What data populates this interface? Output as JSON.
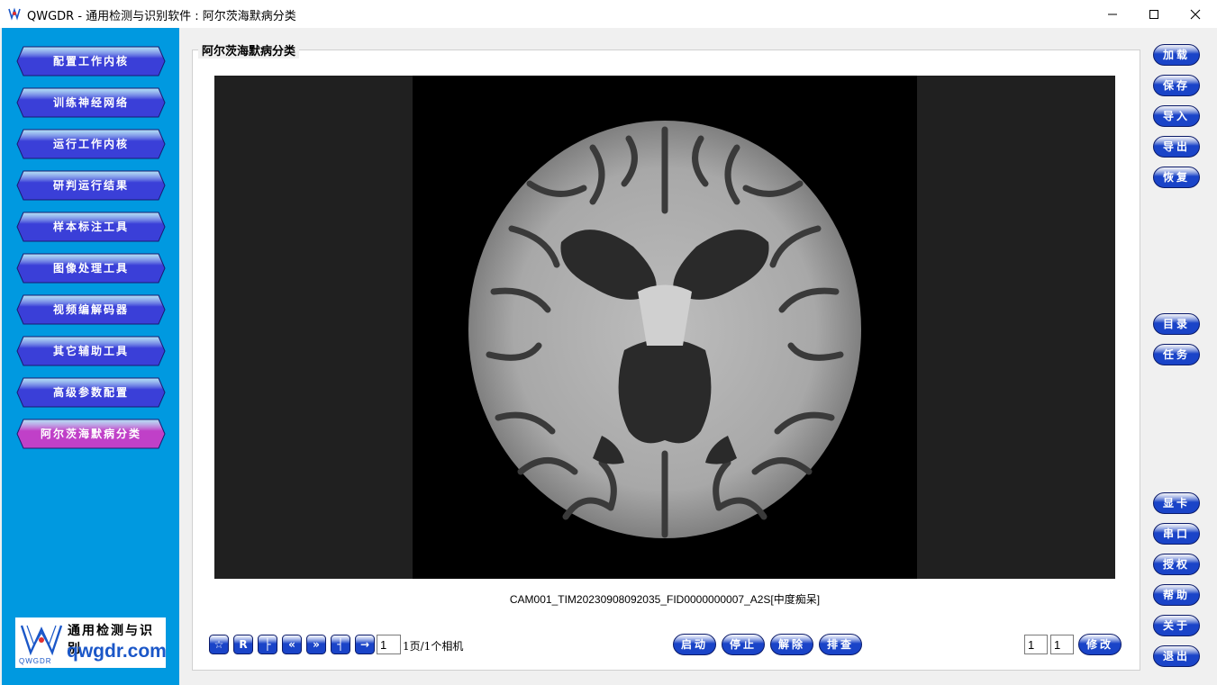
{
  "window": {
    "title": "QWGDR - 通用检测与识别软件 : 阿尔茨海默病分类"
  },
  "sidebar": {
    "items": [
      {
        "label": "配置工作内核"
      },
      {
        "label": "训练神经网络"
      },
      {
        "label": "运行工作内核"
      },
      {
        "label": "研判运行结果"
      },
      {
        "label": "样本标注工具"
      },
      {
        "label": "图像处理工具"
      },
      {
        "label": "视频编解码器"
      },
      {
        "label": "其它辅助工具"
      },
      {
        "label": "高级参数配置"
      },
      {
        "label": "阿尔茨海默病分类",
        "active": true
      }
    ],
    "logo": {
      "title": "通用检测与识别",
      "url_text": "qwgdr.com",
      "brand": "QWGDR"
    }
  },
  "main": {
    "group_title": "阿尔茨海默病分类",
    "caption": "CAM001_TIM20230908092035_FID0000000007_A2S[中度痴呆]",
    "nav_buttons": [
      {
        "icon": "star-icon",
        "glyph": "☆"
      },
      {
        "icon": "r-icon",
        "glyph": "R"
      },
      {
        "icon": "first-icon",
        "glyph": "├"
      },
      {
        "icon": "prev-page-icon",
        "glyph": "«"
      },
      {
        "icon": "next-page-icon",
        "glyph": "»"
      },
      {
        "icon": "last-icon",
        "glyph": "┤"
      },
      {
        "icon": "goto-icon",
        "glyph": "→"
      }
    ],
    "page_input": "1",
    "page_info": "1页/1个相机",
    "actions": {
      "start": "启动",
      "stop": "停止",
      "release": "解除",
      "check": "排查"
    },
    "field_a": "1",
    "field_b": "1",
    "modify": "修改"
  },
  "right_panel": {
    "top": [
      "加载",
      "保存",
      "导入",
      "导出",
      "恢复"
    ],
    "middle": [
      "目录",
      "任务"
    ],
    "bottom": [
      "显卡",
      "串口",
      "授权",
      "帮助",
      "关于",
      "退出"
    ]
  },
  "colors": {
    "sidebar_bg": "#0099e0",
    "nav_button": "#3a3fd8",
    "nav_button_active": "#c040c8",
    "action_button": "#1a44c8"
  }
}
